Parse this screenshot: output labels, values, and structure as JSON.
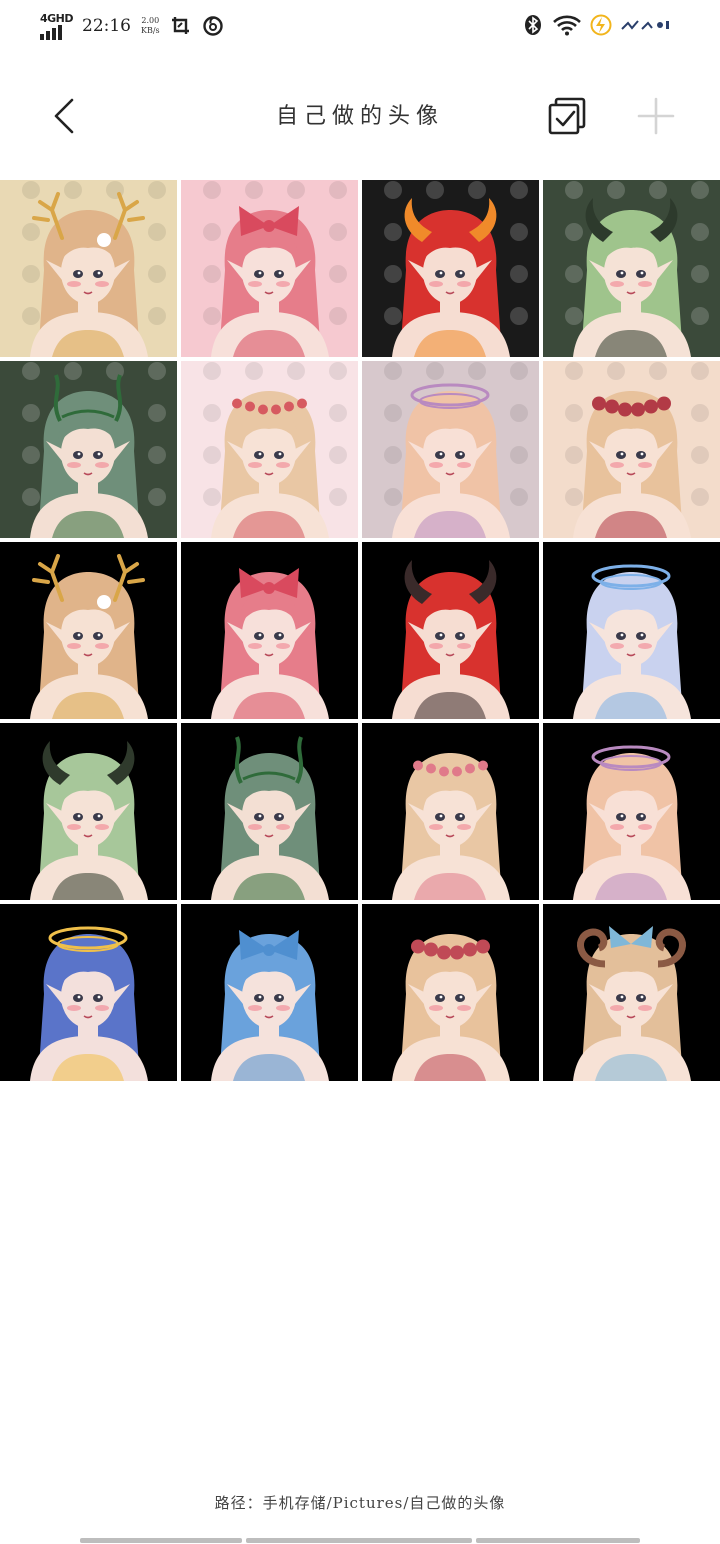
{
  "status_bar": {
    "network": "4GHD",
    "time": "22:16",
    "speed_value": "2.00",
    "speed_unit": "KB/s",
    "battery": "78"
  },
  "header": {
    "title": "自己做的头像",
    "back_icon": "chevron-left-icon",
    "select_icon": "multi-select-icon",
    "add_icon": "plus-icon"
  },
  "gallery": {
    "columns": 4,
    "images": [
      {
        "bg": "#e9d9b4",
        "hair": "#e0b48a",
        "skin": "#f6e1d3",
        "accent": "#d9a648",
        "top": "antlers"
      },
      {
        "bg": "#f6c9d0",
        "hair": "#e67d8a",
        "skin": "#f7e0da",
        "accent": "#d94a5e",
        "top": "bow"
      },
      {
        "bg": "#1a1a1a",
        "hair": "#d8322e",
        "skin": "#f6ddd2",
        "accent": "#f08a2a",
        "top": "horns"
      },
      {
        "bg": "#3b4a3a",
        "hair": "#9fc48c",
        "skin": "#f5e2d6",
        "accent": "#2d3a2c",
        "top": "horns"
      },
      {
        "bg": "#3b4a3a",
        "hair": "#6f8f7a",
        "skin": "#f3dfd3",
        "accent": "#2f6b3a",
        "top": "vines"
      },
      {
        "bg": "#f8e3e6",
        "hair": "#e9c7a4",
        "skin": "#f7e2d6",
        "accent": "#d65a60",
        "top": "flowers"
      },
      {
        "bg": "#d7c8cc",
        "hair": "#f0c3a6",
        "skin": "#f8e0d6",
        "accent": "#b98ac0",
        "top": "halo"
      },
      {
        "bg": "#f3dccb",
        "hair": "#e8c29c",
        "skin": "#f7e1d4",
        "accent": "#b23a46",
        "top": "roses"
      },
      {
        "bg": "#000000",
        "hair": "#e0b48a",
        "skin": "#f6e1d3",
        "accent": "#d9a648",
        "top": "antlers"
      },
      {
        "bg": "#000000",
        "hair": "#e67d8a",
        "skin": "#f7e0da",
        "accent": "#d94a5e",
        "top": "bow"
      },
      {
        "bg": "#000000",
        "hair": "#d8322e",
        "skin": "#f6ddd2",
        "accent": "#3a2a2a",
        "top": "horns"
      },
      {
        "bg": "#000000",
        "hair": "#c9d2ef",
        "skin": "#f6e4dc",
        "accent": "#7db0e8",
        "top": "halo"
      },
      {
        "bg": "#000000",
        "hair": "#a7c79a",
        "skin": "#f5e2d6",
        "accent": "#2f3a2c",
        "top": "horns"
      },
      {
        "bg": "#000000",
        "hair": "#6f8f7a",
        "skin": "#f3dfd3",
        "accent": "#2f6b3a",
        "top": "vines"
      },
      {
        "bg": "#000000",
        "hair": "#e9c7a4",
        "skin": "#f7e2d6",
        "accent": "#e07a8a",
        "top": "flowers"
      },
      {
        "bg": "#000000",
        "hair": "#f0c3a6",
        "skin": "#f8e0d6",
        "accent": "#b98ac0",
        "top": "halo"
      },
      {
        "bg": "#000000",
        "hair": "#5a74c9",
        "skin": "#f3e0dc",
        "accent": "#f0c04a",
        "top": "halo"
      },
      {
        "bg": "#000000",
        "hair": "#6aa2dc",
        "skin": "#f5e2dc",
        "accent": "#4f8fd0",
        "top": "bow"
      },
      {
        "bg": "#000000",
        "hair": "#e8c29c",
        "skin": "#f7e1d4",
        "accent": "#c04a56",
        "top": "roses"
      },
      {
        "bg": "#000000",
        "hair": "#e3bf9a",
        "skin": "#f7e2d6",
        "accent": "#7fb7d8",
        "top": "rams"
      }
    ]
  },
  "footer": {
    "path": "路径：手机存储/Pictures/自己做的头像"
  }
}
